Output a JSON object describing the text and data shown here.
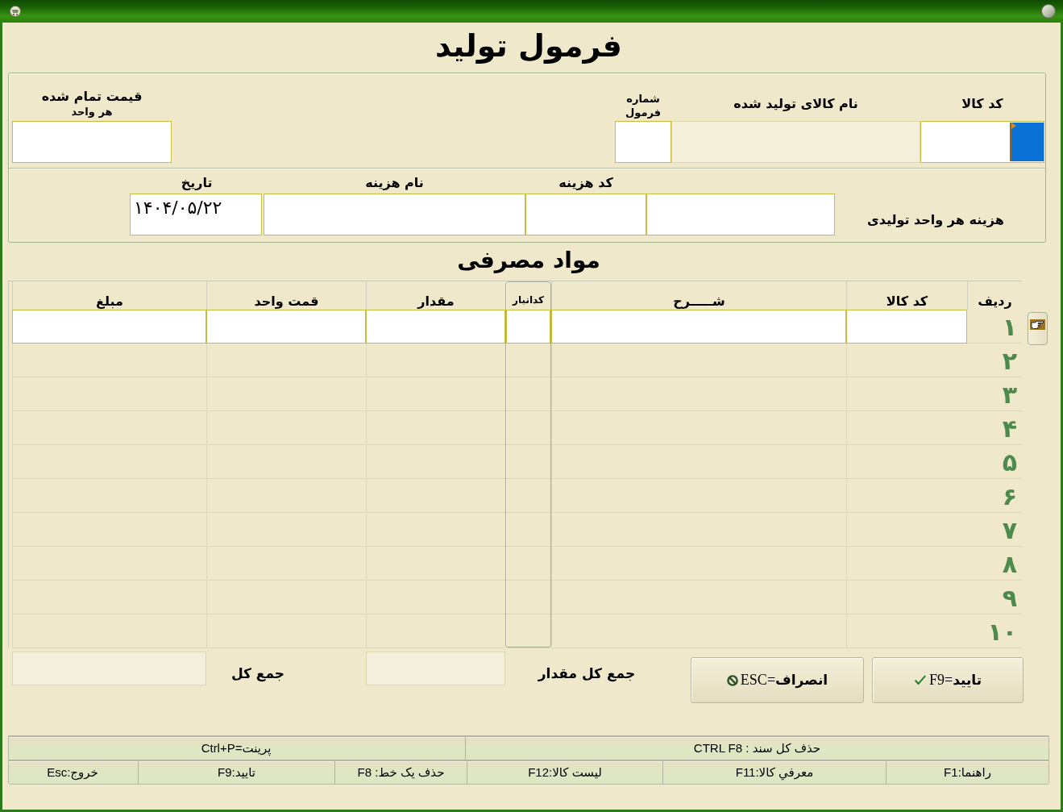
{
  "form": {
    "title": "فرمول تولید"
  },
  "product": {
    "fields": [
      {
        "label": "کد کالا",
        "readonly": false,
        "focused": true
      },
      {
        "label": "نام کالای تولید شده",
        "readonly": true,
        "focused": false
      },
      {
        "label": "شماره فرمول",
        "readonly": false,
        "focused": false
      },
      {
        "label": "قیمت تمام شده",
        "sublabel": "هر واحد",
        "readonly": false,
        "focused": false
      }
    ]
  },
  "cost": {
    "fields": [
      {
        "kind": "side",
        "label": "هزینه هر واحد تولیدی"
      },
      {
        "kind": "top",
        "label": "کد هزینه"
      },
      {
        "kind": "top",
        "label": "نام هزینه"
      },
      {
        "kind": "top",
        "label": "تاریخ",
        "value": "۱۴۰۴/۰۵/۲۲"
      }
    ]
  },
  "materials": {
    "title": "مواد مصرفی",
    "columns": [
      "ردیف",
      "کد کالا",
      "شـــــرح",
      "کدانبار",
      "مقدار",
      "قمت واحد",
      "مبلغ"
    ],
    "rows": [
      {
        "number": "۱",
        "selected": true
      },
      {
        "number": "۲",
        "selected": false
      },
      {
        "number": "۳",
        "selected": false
      },
      {
        "number": "۴",
        "selected": false
      },
      {
        "number": "۵",
        "selected": false
      },
      {
        "number": "۶",
        "selected": false
      },
      {
        "number": "۷",
        "selected": false
      },
      {
        "number": "۸",
        "selected": false
      },
      {
        "number": "۹",
        "selected": false
      },
      {
        "number": "۱۰",
        "selected": false
      }
    ]
  },
  "buttons": [
    {
      "kind": "confirm",
      "label": "**تایید**=F9"
    },
    {
      "kind": "cancel",
      "label": "**انصراف**=ESC"
    }
  ],
  "totals": [
    {
      "label": "جمع کل مقدار"
    },
    {
      "label": "جمع کل"
    }
  ],
  "status_bar": {
    "upper_hints": [
      "حذف کل سند : CTRL F8",
      "پرینت=Ctrl+P"
    ],
    "lower_hints": [
      "راهنما:F1",
      "معرفي کالا:F11",
      "لیست کالا:F12",
      "حذف یک خط: F8",
      "تایید:F9",
      "خروج:Esc"
    ]
  }
}
